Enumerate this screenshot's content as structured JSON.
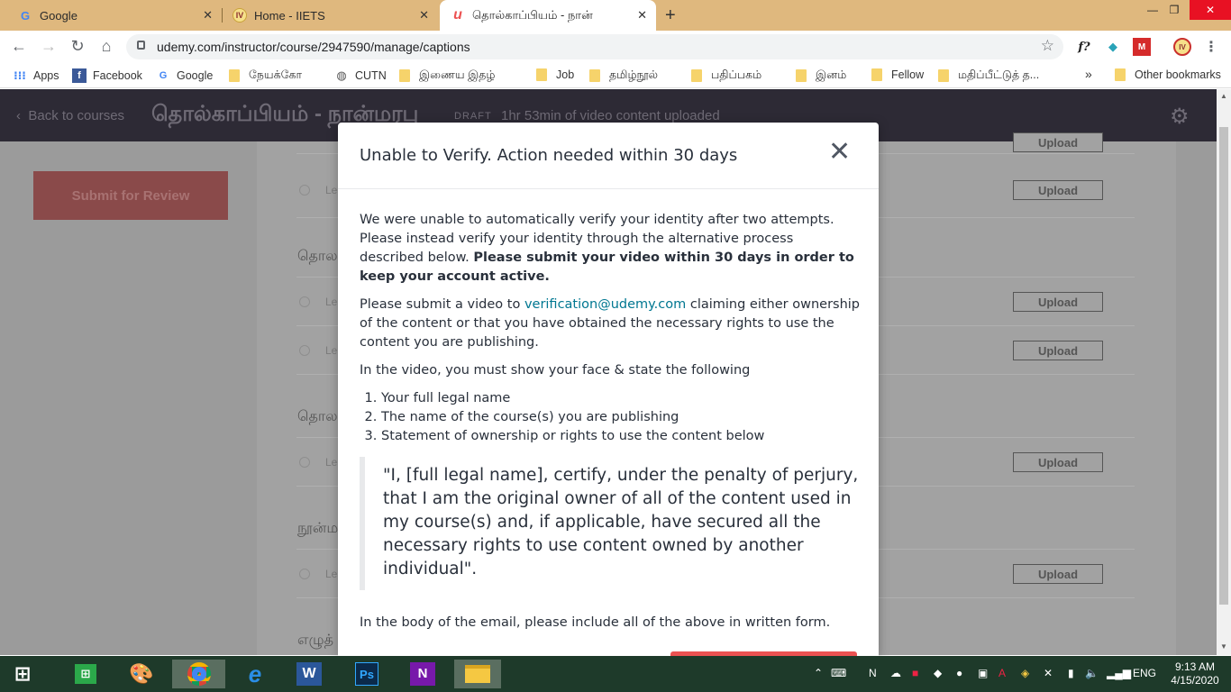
{
  "browser": {
    "tabs": [
      {
        "title": "Google",
        "favicon": "G"
      },
      {
        "title": "Home - IIETS",
        "favicon": "IV"
      },
      {
        "title": "தொல்காப்பியம் - நான்",
        "favicon": "u"
      }
    ],
    "window_controls": {
      "minimize": "—",
      "maximize": "❐",
      "close": "✕"
    },
    "url": "udemy.com/instructor/course/2947590/manage/captions",
    "extensions": [
      "f?",
      "◆",
      "M",
      "IV"
    ],
    "bookmarks": [
      {
        "label": "Apps",
        "icon": "apps-icon"
      },
      {
        "label": "Facebook",
        "icon": "facebook-icon"
      },
      {
        "label": "Google",
        "icon": "google-icon"
      },
      {
        "label": "நேயக்கோ",
        "icon": "folder-icon"
      },
      {
        "label": "CUTN",
        "icon": "globe-icon"
      },
      {
        "label": "இணைய இதழ்",
        "icon": "folder-icon"
      },
      {
        "label": "Job",
        "icon": "folder-icon"
      },
      {
        "label": "தமிழ்நூல்",
        "icon": "folder-icon"
      },
      {
        "label": "பதிப்பகம்",
        "icon": "folder-icon"
      },
      {
        "label": "இனம்",
        "icon": "folder-icon"
      },
      {
        "label": "Fellow",
        "icon": "folder-icon"
      },
      {
        "label": "மதிப்பீட்டுத் த...",
        "icon": "folder-icon"
      }
    ],
    "bookmarks_overflow": "»",
    "other_bookmarks": "Other bookmarks"
  },
  "page": {
    "back_link": "Back to courses",
    "course_title": "தொல்காப்பியம் - நான்மரபு",
    "status": "DRAFT",
    "uploaded_info": "1hr 53min of video content uploaded",
    "submit_button": "Submit for Review",
    "section_titles": [
      "தொல",
      "தொல",
      "நூன்ம",
      "எழுத்"
    ],
    "row_prefix": "Le",
    "upload_label": "Upload"
  },
  "modal": {
    "title": "Unable to Verify. Action needed within 30 days",
    "intro": "We were unable to automatically verify your identity after two attempts. Please instead verify your identity through the alternative process described below.",
    "intro_bold": "Please submit your video within 30 days in order to keep your account active.",
    "submit_prefix": "Please submit a video to",
    "email": "verification@udemy.com",
    "submit_suffix": "claiming either ownership of the content or that you have obtained the necessary rights to use the content you are publishing.",
    "video_instruction": "In the video, you must show your face & state the following",
    "list_items": [
      "Your full legal name",
      "The name of the course(s) you are publishing",
      "Statement of ownership or rights to use the content below"
    ],
    "statement": "\"I, [full legal name], certify, under the penalty of perjury, that I am the original owner of all of the content used in my course(s) and, if applicable, have secured all the necessary rights to use content owned by another individual\".",
    "email_body_note": "In the body of the email, please include all of the above in written form."
  },
  "taskbar": {
    "apps": [
      "start",
      "store",
      "paint",
      "chrome",
      "edge",
      "word",
      "photoshop",
      "onenote",
      "explorer"
    ],
    "language": "ENG",
    "time": "9:13 AM",
    "date": "4/15/2020"
  },
  "colors": {
    "tabstrip": "#dfb87e",
    "page_header": "#2d2a35",
    "overlay_gray": "#9b9b9b",
    "link": "#007791",
    "brand_red": "#ec5252",
    "taskbar": "#1e3a2a"
  }
}
